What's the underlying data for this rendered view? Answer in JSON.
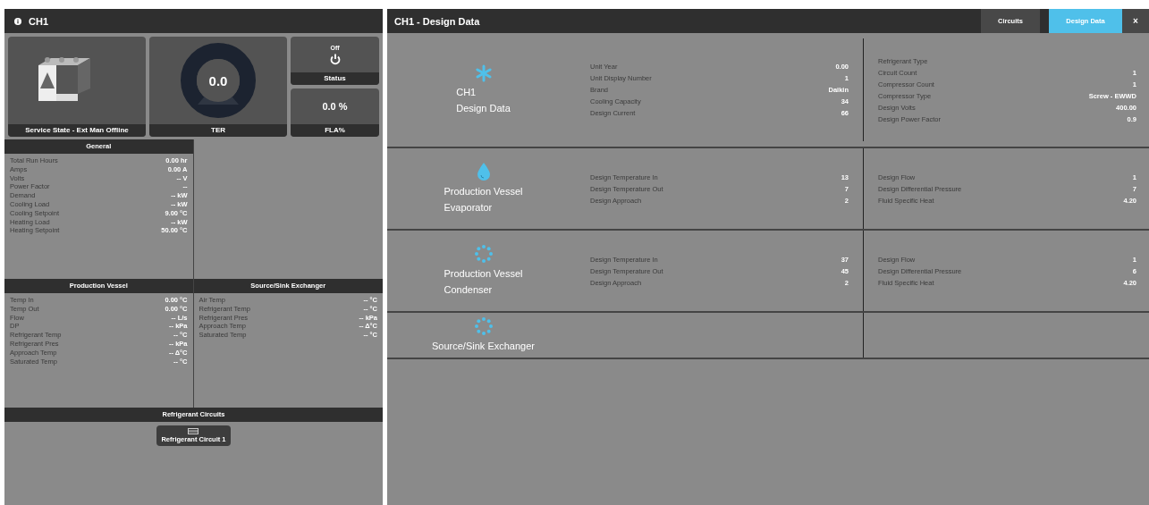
{
  "unit_panel": {
    "title": "CH1",
    "unit_tile": {
      "label": "Service State - Ext Man Offline"
    },
    "ter_tile": {
      "value": "0.0",
      "label": "TER"
    },
    "status_tile": {
      "state": "Off",
      "label": "Status"
    },
    "fla_tile": {
      "value": "0.0 %",
      "label": "FLA%"
    },
    "general": {
      "title": "General",
      "rows": [
        {
          "label": "Total Run Hours",
          "value": "0.00 hr"
        },
        {
          "label": "Amps",
          "value": "0.00 A"
        },
        {
          "label": "Volts",
          "value": "-- V"
        },
        {
          "label": "Power Factor",
          "value": "--"
        },
        {
          "label": "Demand",
          "value": "-- kW"
        },
        {
          "label": "Cooling Load",
          "value": "-- kW"
        },
        {
          "label": "Cooling Setpoint",
          "value": "9.00 °C"
        },
        {
          "label": "Heating Load",
          "value": "-- kW"
        },
        {
          "label": "Heating Setpoint",
          "value": "50.00 °C"
        }
      ]
    },
    "production_vessel": {
      "title": "Production Vessel",
      "rows": [
        {
          "label": "Temp In",
          "value": "0.00 °C"
        },
        {
          "label": "Temp Out",
          "value": "0.00 °C"
        },
        {
          "label": "Flow",
          "value": "-- L/s"
        },
        {
          "label": "DP",
          "value": "-- kPa"
        },
        {
          "label": "Refrigerant Temp",
          "value": "-- °C"
        },
        {
          "label": "Refrigerant Pres",
          "value": "-- kPa"
        },
        {
          "label": "Approach Temp",
          "value": "-- Δ°C"
        },
        {
          "label": "Saturated Temp",
          "value": "-- °C"
        }
      ]
    },
    "source_sink_exchanger": {
      "title": "Source/Sink Exchanger",
      "rows": [
        {
          "label": "Air Temp",
          "value": "-- °C"
        },
        {
          "label": "Refrigerant Temp",
          "value": "-- °C"
        },
        {
          "label": "Refrigerant Pres",
          "value": "-- kPa"
        },
        {
          "label": "Approach Temp",
          "value": "-- Δ°C"
        },
        {
          "label": "Saturated Temp",
          "value": "-- °C"
        }
      ]
    },
    "refrigerant_circuits": {
      "title": "Refrigerant Circuits",
      "circuits": [
        {
          "label": "Refrigerant Circuit 1"
        }
      ]
    }
  },
  "design_panel": {
    "title": "CH1 - Design Data",
    "tabs": [
      {
        "label": "Circuits",
        "selected": false
      },
      {
        "label": "Design Data",
        "selected": true
      }
    ],
    "close": "×",
    "sections": [
      {
        "kind": "snowflake",
        "title": [
          "CH1",
          "Design Data"
        ],
        "left_rows": [
          {
            "label": "Unit Year",
            "value": "0.00"
          },
          {
            "label": "Unit Display Number",
            "value": "1"
          },
          {
            "label": "Brand",
            "value": "Daikin"
          },
          {
            "label": "Cooling Capacity",
            "value": "34"
          },
          {
            "label": "Design Current",
            "value": "66"
          }
        ],
        "right_rows": [
          {
            "label": "Refrigerant Type"
          },
          {
            "label": "Circuit Count",
            "value": "1"
          },
          {
            "label": "Compressor Count",
            "value": "1"
          },
          {
            "label": "Compressor Type",
            "value": "Screw - EWWD"
          },
          {
            "label": "Design Volts",
            "value": "400.00"
          },
          {
            "label": "Design Power Factor",
            "value": "0.9"
          }
        ]
      },
      {
        "kind": "drop",
        "title": [
          "Production Vessel",
          "Evaporator"
        ],
        "left_rows": [
          {
            "label": "Design Temperature In",
            "value": "13"
          },
          {
            "label": "Design Temperature Out",
            "value": "7"
          },
          {
            "label": "Design Approach",
            "value": "2"
          }
        ],
        "right_rows": [
          {
            "label": "Design Flow",
            "value": "1"
          },
          {
            "label": "Design Differential Pressure",
            "value": "7"
          },
          {
            "label": "Fluid Specific Heat",
            "value": "4.20"
          }
        ]
      },
      {
        "kind": "dots",
        "title": [
          "Production Vessel",
          "Condenser"
        ],
        "left_rows": [
          {
            "label": "Design Temperature In",
            "value": "37"
          },
          {
            "label": "Design Temperature Out",
            "value": "45"
          },
          {
            "label": "Design Approach",
            "value": "2"
          }
        ],
        "right_rows": [
          {
            "label": "Design Flow",
            "value": "1"
          },
          {
            "label": "Design Differential Pressure",
            "value": "6"
          },
          {
            "label": "Fluid Specific Heat",
            "value": "4.20"
          }
        ]
      },
      {
        "kind": "dots",
        "title": [
          "Source/Sink Exchanger"
        ]
      }
    ]
  }
}
